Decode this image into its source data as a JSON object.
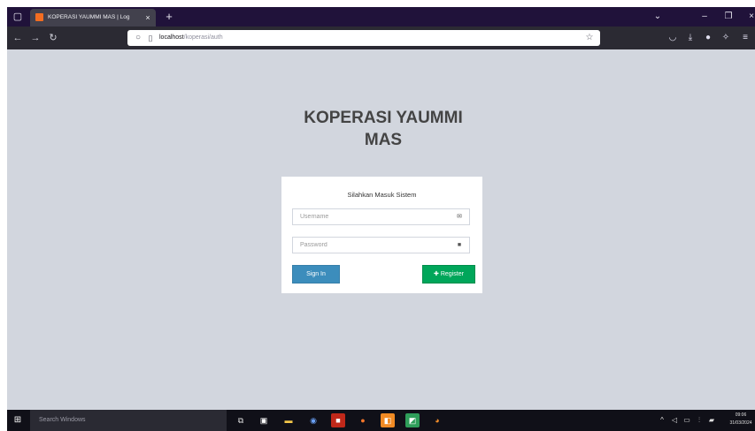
{
  "browser": {
    "tab_title": "KOPERASI YAUMMI MAS | Log",
    "tab_close": "×",
    "new_tab": "+",
    "url_host": "localhost",
    "url_path": "/koperasi/auth",
    "icons": {
      "tab_list": "tab-list-icon",
      "back": "back-arrow-icon",
      "forward": "forward-arrow-icon",
      "reload": "reload-icon",
      "shield": "shield-icon",
      "page": "page-icon",
      "bookmark": "star-icon",
      "pocket": "pocket-icon",
      "download": "download-icon",
      "account": "account-icon",
      "extensions": "extensions-icon",
      "menu": "hamburger-menu-icon"
    },
    "colors": {
      "titlebar": "#20123a",
      "tab": "#42414d",
      "toolbar": "#2b2a33"
    }
  },
  "page": {
    "logo_line1": "KOPERASI YAUMMI",
    "logo_line2": "MAS",
    "login_message": "Silahkan Masuk Sistem",
    "username_placeholder": "Username",
    "username_value": "",
    "password_placeholder": "Password",
    "password_value": "",
    "signin_label": "Sign In",
    "register_label": "Register",
    "colors": {
      "background": "#d2d6de",
      "signin": "#3c8dbc",
      "register": "#00a65a"
    }
  },
  "taskbar": {
    "search_placeholder": "Search Windows",
    "clock_time": "09:06",
    "clock_date": "31/03/2024",
    "apps": [
      "task-view-icon",
      "store-icon",
      "file-explorer-icon",
      "chrome-icon",
      "app-red-icon",
      "firefox-orange-icon",
      "app-orange-icon",
      "app-green-icon",
      "firefox-icon"
    ]
  }
}
